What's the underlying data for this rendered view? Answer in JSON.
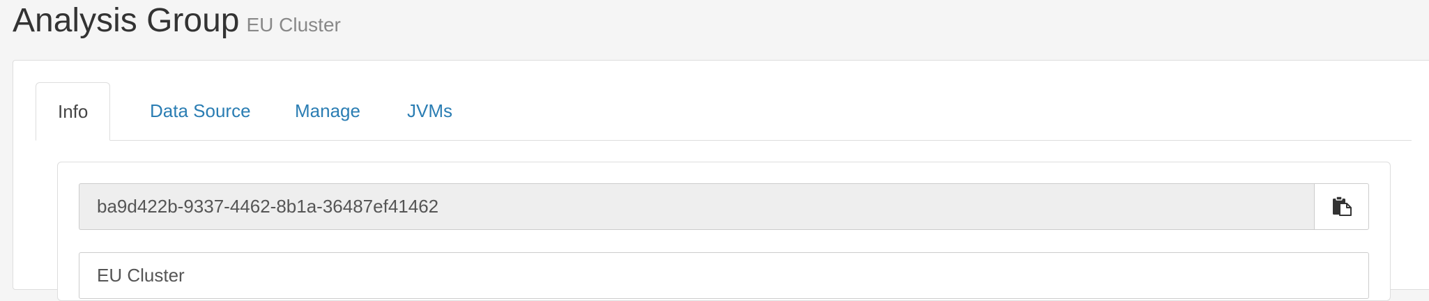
{
  "header": {
    "title": "Analysis Group",
    "subtitle": "EU Cluster"
  },
  "tabs": [
    {
      "label": "Info",
      "active": true
    },
    {
      "label": "Data Source",
      "active": false
    },
    {
      "label": "Manage",
      "active": false
    },
    {
      "label": "JVMs",
      "active": false
    }
  ],
  "info": {
    "id_value": "ba9d422b-9337-4462-8b1a-36487ef41462",
    "copy_icon": "clipboard-copy-icon",
    "name_value": "EU Cluster"
  },
  "colors": {
    "link": "#2a7db3",
    "readonly_bg": "#eeeeee",
    "border": "#dddddd"
  }
}
